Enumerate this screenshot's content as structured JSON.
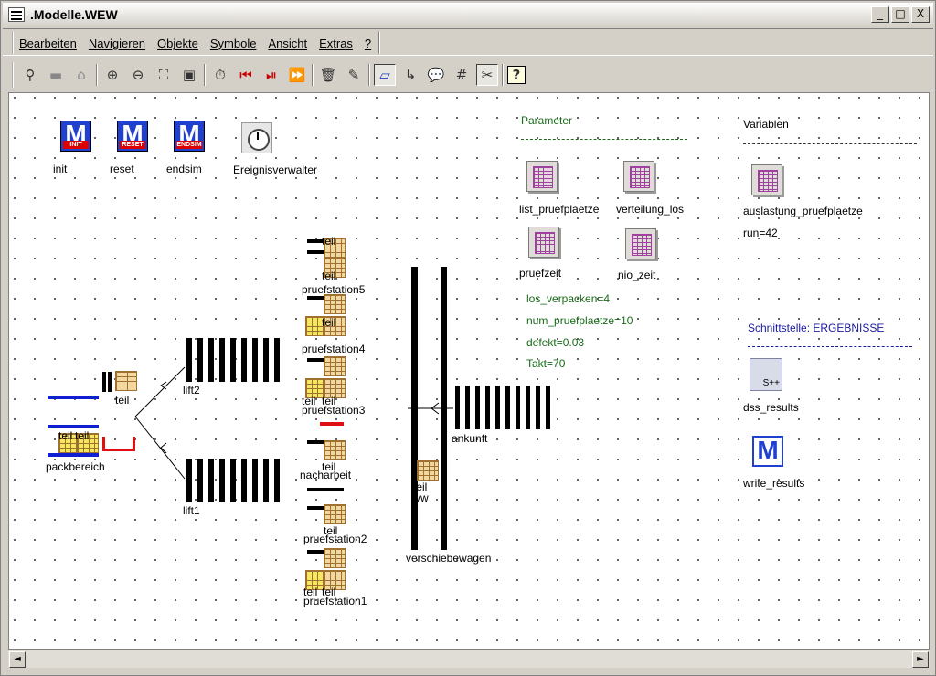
{
  "window": {
    "title": ".Modelle.WEW",
    "caption_buttons": [
      "_",
      "□",
      "X"
    ]
  },
  "menu": {
    "items": [
      "Bearbeiten",
      "Navigieren",
      "Objekte",
      "Symbole",
      "Ansicht",
      "Extras",
      "?"
    ]
  },
  "toolbar": {
    "icons": [
      "binoculars-icon",
      "folder-icon",
      "home-icon",
      "zoom-in-icon",
      "zoom-out-icon",
      "zoom-fit-icon",
      "screen-icon",
      "timer-icon",
      "rewind-icon",
      "step-icon",
      "fast-forward-icon",
      "delete-icon",
      "brush-icon",
      "eraser-icon",
      "connector-icon",
      "comment-icon",
      "grid-icon",
      "tools-icon",
      "help-icon"
    ]
  },
  "canvas": {
    "methods": {
      "init": "init",
      "init_tag": "INIT",
      "reset": "reset",
      "reset_tag": "RESET",
      "endsim": "endsim",
      "endsim_tag": "ENDSIM",
      "event_controller": "Ereignisverwalter"
    },
    "parameter": {
      "header": "Parameter",
      "tables": {
        "list_pruefplaetze": "list_pruefplaetze",
        "verteilung_los": "verteilung_los",
        "pruefzeit": "pruefzeit",
        "nio_zeit": "nio_zeit"
      },
      "values": {
        "los_verpacken": "los_verpacken=4",
        "num_pruefplaetze": "num_pruefplaetze=10",
        "defekt": "defekt=0.03",
        "takt": "Takt=70"
      }
    },
    "variablen": {
      "header": "Variablen",
      "table": "auslastung_pruefplaetze",
      "run": "run=42"
    },
    "interface": {
      "header": "Schnittstelle: ERGEBNISSE",
      "dss_results": "dss_results",
      "splus_label": "S++",
      "write_results": "write_results"
    },
    "objects": {
      "pruefstation5": "pruefstation5",
      "pruefstation4": "pruefstation4",
      "pruefstation3": "pruefstation3",
      "pruefstation2": "pruefstation2",
      "pruefstation1": "pruefstation1",
      "nacharbeit": "nacharbeit",
      "lift1": "lift1",
      "lift2": "lift2",
      "teil": "teil",
      "packbereich": "packbereich",
      "ankunft": "ankunft",
      "verschiebewagen": "verschiebewagen",
      "part_label": "teil",
      "vw": "vw"
    }
  },
  "scrollbar": {
    "left": "◄",
    "right": "►"
  }
}
